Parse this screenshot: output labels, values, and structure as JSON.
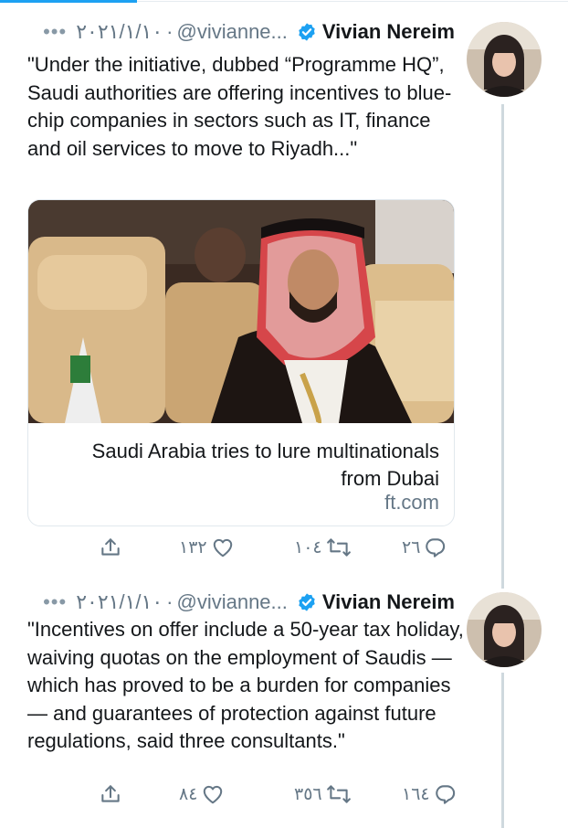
{
  "tweets": [
    {
      "author": {
        "name": "Vivian Nereim",
        "handle": "@vivianne..."
      },
      "date": "٢٠٢١/١/١٠",
      "text": "\"Under the initiative, dubbed “Programme HQ”, Saudi authorities are offering incentives to blue-chip companies in sectors such as IT, finance and oil services to move to Riyadh...\"",
      "card": {
        "title": "Saudi Arabia tries to lure multinationals from Dubai",
        "domain": "ft.com"
      },
      "counts": {
        "likes": "١٣٢",
        "retweets": "١٠٤",
        "replies": "٢٦"
      }
    },
    {
      "author": {
        "name": "Vivian Nereim",
        "handle": "@vivianne..."
      },
      "date": "٢٠٢١/١/١٠",
      "text": "\"Incentives on offer include a 50-year tax holiday, waiving quotas on the employment of Saudis — which has proved to be a burden for companies — and guarantees of protection against future regulations, said three consultants.\"",
      "counts": {
        "likes": "٨٤",
        "retweets": "٣٥٦",
        "replies": "١٦٤"
      }
    }
  ],
  "ui": {
    "separator": "·",
    "more": "•••",
    "icons": {
      "more": "more-dots-icon",
      "verified": "verified-badge-icon",
      "share": "share-icon",
      "like": "heart-icon",
      "retweet": "retweet-icon",
      "reply": "reply-icon"
    }
  },
  "colors": {
    "accent": "#1da1f2",
    "text": "#14171a",
    "secondary": "#657786",
    "thread": "#cfd9de",
    "border": "#e1e8ed"
  }
}
